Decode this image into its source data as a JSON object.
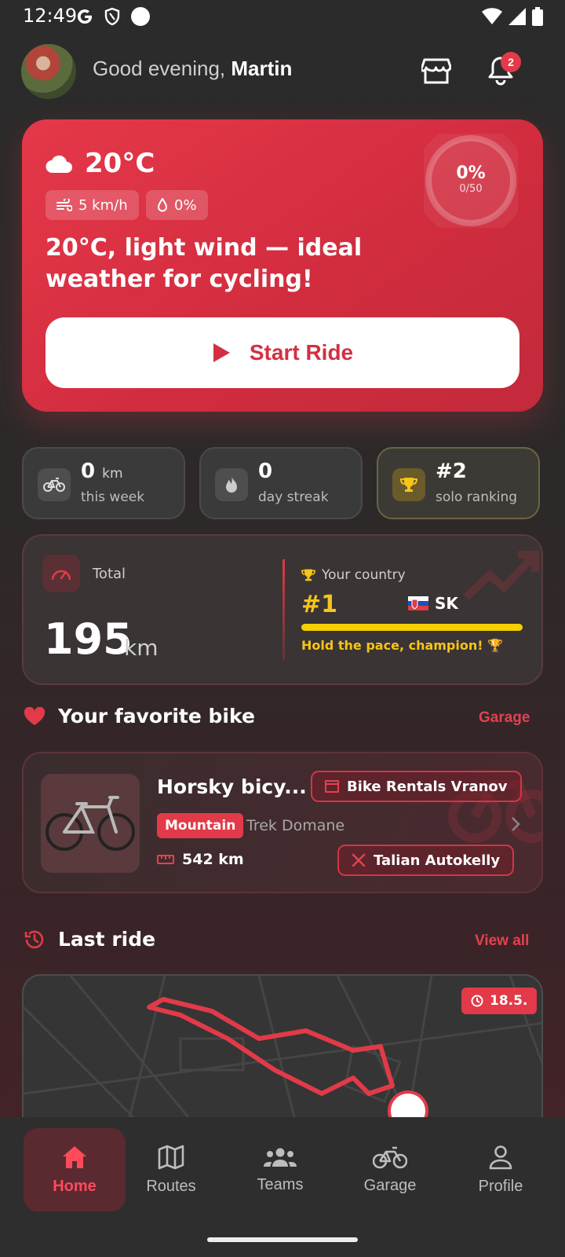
{
  "status_bar": {
    "time": "12:49"
  },
  "header": {
    "greeting": "Good evening,",
    "user_name": "Martin",
    "notification_count": "2"
  },
  "weather_card": {
    "temperature": "20°C",
    "wind": "5 km/h",
    "precipitation": "0%",
    "message": "20°C, light wind — ideal weather for cycling!",
    "goal_percent": "0%",
    "goal_progress": "0/50",
    "start_button": "Start Ride"
  },
  "stats": {
    "week": {
      "value": "0",
      "unit": "km",
      "label": "this week"
    },
    "streak": {
      "value": "0",
      "label": "day streak"
    },
    "ranking": {
      "value": "#2",
      "label": "solo ranking"
    }
  },
  "total_card": {
    "label": "Total",
    "value": "195",
    "unit": "km",
    "country_label": "Your country",
    "country_rank": "#1",
    "country_code": "SK",
    "country_progress": 1.0,
    "cheer": "Hold the pace, champion! 🏆"
  },
  "favorite_bike": {
    "section_title": "Your favorite bike",
    "link": "Garage",
    "name": "Horsky bicy...",
    "rental": "Bike Rentals Vranov",
    "type": "Mountain",
    "model": "Trek Domane",
    "distance": "542 km",
    "service": "Talian Autokelly"
  },
  "last_ride": {
    "section_title": "Last ride",
    "link": "View all",
    "date": "18.5."
  },
  "nav": {
    "home": "Home",
    "routes": "Routes",
    "teams": "Teams",
    "garage": "Garage",
    "profile": "Profile"
  },
  "colors": {
    "accent": "#e23a48",
    "gold": "#f5c518"
  }
}
